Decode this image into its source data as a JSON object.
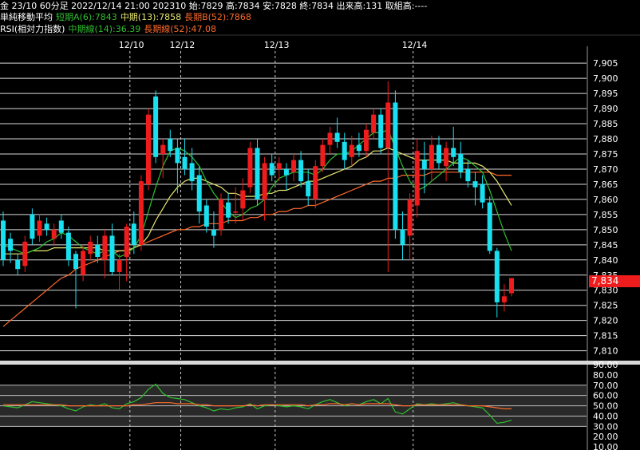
{
  "header": {
    "line1": "金 23/10 60分足 2022/12/14 21:00 202310 始:7829 高:7834 安:7828 終:7834 出来高:131 取組高:----",
    "line2": {
      "title": "単純移動平均",
      "short": "短期A(6):7843",
      "mid": "中期(13):7858",
      "long": "長期B(52):7868"
    },
    "line3": {
      "title": "RSI(相対力指数)",
      "mid": "中期線(14):36.39",
      "long": "長期線(52):47.08"
    }
  },
  "current_price": "7,834",
  "colors": {
    "up": "#ee1c1c",
    "down": "#19e0f0",
    "ma_short": "#2fbf2f",
    "ma_mid": "#e8e870",
    "ma_long": "#ff6a2a",
    "rsi_mid": "#2fbf2f",
    "rsi_long": "#ff6a2a",
    "grid": "#ffffff",
    "band": "#4a4a4a"
  },
  "chart_data": [
    {
      "type": "candlestick",
      "title": "金 23/10 60分足",
      "x_dates": [
        "12/10",
        "12/12",
        "12/13",
        "12/14"
      ],
      "ylim": [
        7807,
        7909
      ],
      "yticks": [
        "7,905",
        "7,900",
        "7,895",
        "7,890",
        "7,885",
        "7,880",
        "7,875",
        "7,870",
        "7,865",
        "7,860",
        "7,855",
        "7,850",
        "7,845",
        "7,840",
        "7,835",
        "7,830",
        "7,825",
        "7,820",
        "7,815",
        "7,810"
      ],
      "ohlc": [
        [
          7853,
          7856,
          7838,
          7840
        ],
        [
          7847,
          7849,
          7839,
          7843
        ],
        [
          7840,
          7842,
          7835,
          7837
        ],
        [
          7838,
          7848,
          7836,
          7846
        ],
        [
          7855,
          7857,
          7845,
          7847
        ],
        [
          7848,
          7855,
          7846,
          7853
        ],
        [
          7852,
          7854,
          7848,
          7850
        ],
        [
          7847,
          7852,
          7845,
          7850
        ],
        [
          7853,
          7855,
          7847,
          7849
        ],
        [
          7849,
          7851,
          7838,
          7840
        ],
        [
          7842,
          7843,
          7824,
          7837
        ],
        [
          7835,
          7845,
          7833,
          7843
        ],
        [
          7842,
          7848,
          7840,
          7846
        ],
        [
          7845,
          7848,
          7839,
          7841
        ],
        [
          7840,
          7850,
          7834,
          7848
        ],
        [
          7848,
          7852,
          7835,
          7836
        ],
        [
          7836,
          7842,
          7830,
          7840
        ],
        [
          7841,
          7852,
          7833,
          7851
        ],
        [
          7852,
          7856,
          7842,
          7845
        ],
        [
          7845,
          7868,
          7843,
          7866
        ],
        [
          7865,
          7890,
          7863,
          7888
        ],
        [
          7894,
          7896,
          7872,
          7874
        ],
        [
          7875,
          7880,
          7867,
          7878
        ],
        [
          7880,
          7883,
          7874,
          7876
        ],
        [
          7877,
          7880,
          7862,
          7872
        ],
        [
          7874,
          7880,
          7868,
          7870
        ],
        [
          7872,
          7877,
          7863,
          7866
        ],
        [
          7868,
          7871,
          7852,
          7856
        ],
        [
          7858,
          7860,
          7849,
          7851
        ],
        [
          7850,
          7856,
          7844,
          7848
        ],
        [
          7850,
          7862,
          7848,
          7860
        ],
        [
          7859,
          7862,
          7852,
          7854
        ],
        [
          7856,
          7864,
          7852,
          7856
        ],
        [
          7857,
          7867,
          7853,
          7863
        ],
        [
          7864,
          7879,
          7862,
          7877
        ],
        [
          7877,
          7880,
          7858,
          7860
        ],
        [
          7860,
          7874,
          7853,
          7872
        ],
        [
          7872,
          7875,
          7866,
          7868
        ],
        [
          7870,
          7874,
          7866,
          7872
        ],
        [
          7870,
          7872,
          7863,
          7868
        ],
        [
          7869,
          7875,
          7866,
          7873
        ],
        [
          7873,
          7876,
          7864,
          7866
        ],
        [
          7866,
          7870,
          7858,
          7861
        ],
        [
          7860,
          7873,
          7857,
          7871
        ],
        [
          7871,
          7880,
          7869,
          7878
        ],
        [
          7878,
          7884,
          7875,
          7882
        ],
        [
          7882,
          7887,
          7877,
          7879
        ],
        [
          7879,
          7882,
          7870,
          7873
        ],
        [
          7874,
          7881,
          7871,
          7878
        ],
        [
          7878,
          7882,
          7874,
          7876
        ],
        [
          7876,
          7885,
          7874,
          7883
        ],
        [
          7882,
          7890,
          7880,
          7888
        ],
        [
          7888,
          7890,
          7875,
          7877
        ],
        [
          7877,
          7899,
          7836,
          7892
        ],
        [
          7892,
          7896,
          7847,
          7850
        ],
        [
          7850,
          7856,
          7840,
          7845
        ],
        [
          7848,
          7862,
          7840,
          7860
        ],
        [
          7858,
          7880,
          7854,
          7876
        ],
        [
          7873,
          7879,
          7862,
          7870
        ],
        [
          7870,
          7881,
          7866,
          7878
        ],
        [
          7878,
          7881,
          7870,
          7872
        ],
        [
          7871,
          7879,
          7866,
          7877
        ],
        [
          7877,
          7884,
          7871,
          7874
        ],
        [
          7875,
          7879,
          7867,
          7869
        ],
        [
          7870,
          7873,
          7864,
          7866
        ],
        [
          7866,
          7869,
          7858,
          7864
        ],
        [
          7865,
          7868,
          7857,
          7859
        ],
        [
          7859,
          7861,
          7842,
          7843
        ],
        [
          7843,
          7844,
          7821,
          7826
        ],
        [
          7826,
          7832,
          7823,
          7828
        ],
        [
          7829,
          7834,
          7828,
          7834
        ]
      ],
      "ma_short": [
        7845,
        7844,
        7843,
        7842,
        7843,
        7844,
        7846,
        7847,
        7849,
        7848,
        7846,
        7844,
        7843,
        7842,
        7843,
        7843,
        7841,
        7842,
        7844,
        7848,
        7856,
        7864,
        7871,
        7876,
        7877,
        7876,
        7874,
        7871,
        7866,
        7862,
        7859,
        7856,
        7854,
        7855,
        7857,
        7858,
        7860,
        7864,
        7867,
        7868,
        7869,
        7869,
        7869,
        7868,
        7870,
        7873,
        7875,
        7875,
        7876,
        7878,
        7880,
        7882,
        7882,
        7883,
        7877,
        7871,
        7866,
        7863,
        7864,
        7866,
        7868,
        7870,
        7872,
        7874,
        7873,
        7871,
        7869,
        7863,
        7856,
        7849,
        7843
      ],
      "ma_mid": [
        7842,
        7842,
        7842,
        7842,
        7843,
        7843,
        7843,
        7844,
        7844,
        7844,
        7844,
        7844,
        7844,
        7844,
        7843,
        7843,
        7843,
        7843,
        7844,
        7845,
        7848,
        7853,
        7857,
        7861,
        7864,
        7866,
        7867,
        7867,
        7866,
        7865,
        7864,
        7862,
        7862,
        7861,
        7861,
        7861,
        7862,
        7862,
        7863,
        7863,
        7864,
        7865,
        7866,
        7866,
        7867,
        7868,
        7869,
        7870,
        7871,
        7873,
        7874,
        7876,
        7876,
        7877,
        7876,
        7875,
        7874,
        7873,
        7873,
        7873,
        7873,
        7873,
        7872,
        7872,
        7872,
        7872,
        7871,
        7869,
        7866,
        7862,
        7858
      ],
      "ma_long": [
        7818,
        7820,
        7822,
        7824,
        7826,
        7828,
        7830,
        7832,
        7834,
        7835,
        7837,
        7838,
        7839,
        7840,
        7841,
        7842,
        7843,
        7843,
        7844,
        7845,
        7846,
        7847,
        7848,
        7849,
        7850,
        7850,
        7851,
        7851,
        7852,
        7852,
        7852,
        7853,
        7853,
        7853,
        7854,
        7854,
        7855,
        7855,
        7856,
        7856,
        7857,
        7857,
        7858,
        7858,
        7859,
        7860,
        7861,
        7862,
        7863,
        7864,
        7865,
        7866,
        7866,
        7867,
        7867,
        7868,
        7868,
        7868,
        7868,
        7869,
        7869,
        7869,
        7869,
        7869,
        7869,
        7869,
        7869,
        7869,
        7868,
        7868,
        7868
      ]
    },
    {
      "type": "line",
      "title": "RSI(相対力指数)",
      "ylim": [
        7,
        90
      ],
      "yticks": [
        "90.00",
        "80.00",
        "70.00",
        "60.00",
        "50.00",
        "40.00",
        "30.00",
        "20.00",
        "10.00"
      ],
      "shaded_band": [
        30,
        70
      ],
      "series": [
        {
          "name": "中期線(14)",
          "values": [
            50,
            49,
            48,
            51,
            54,
            53,
            52,
            51,
            50,
            47,
            45,
            49,
            51,
            50,
            52,
            48,
            47,
            52,
            54,
            58,
            66,
            71,
            62,
            58,
            57,
            56,
            53,
            50,
            48,
            45,
            47,
            46,
            48,
            49,
            52,
            47,
            50,
            51,
            50,
            49,
            50,
            49,
            47,
            51,
            54,
            56,
            53,
            50,
            52,
            51,
            54,
            56,
            52,
            57,
            44,
            42,
            47,
            52,
            51,
            52,
            51,
            52,
            53,
            51,
            50,
            49,
            48,
            41,
            33,
            34,
            36
          ]
        },
        {
          "name": "長期線(52)",
          "values": [
            51,
            51,
            51,
            51,
            51,
            51,
            51,
            51,
            51,
            50,
            50,
            50,
            50,
            50,
            50,
            50,
            50,
            50,
            51,
            51,
            52,
            53,
            53,
            53,
            52,
            52,
            52,
            51,
            51,
            50,
            50,
            50,
            50,
            50,
            51,
            50,
            51,
            51,
            51,
            51,
            51,
            51,
            50,
            51,
            51,
            52,
            52,
            51,
            52,
            51,
            52,
            52,
            52,
            52,
            51,
            50,
            50,
            51,
            51,
            51,
            51,
            51,
            51,
            51,
            50,
            50,
            50,
            49,
            48,
            47,
            47
          ]
        }
      ]
    }
  ]
}
